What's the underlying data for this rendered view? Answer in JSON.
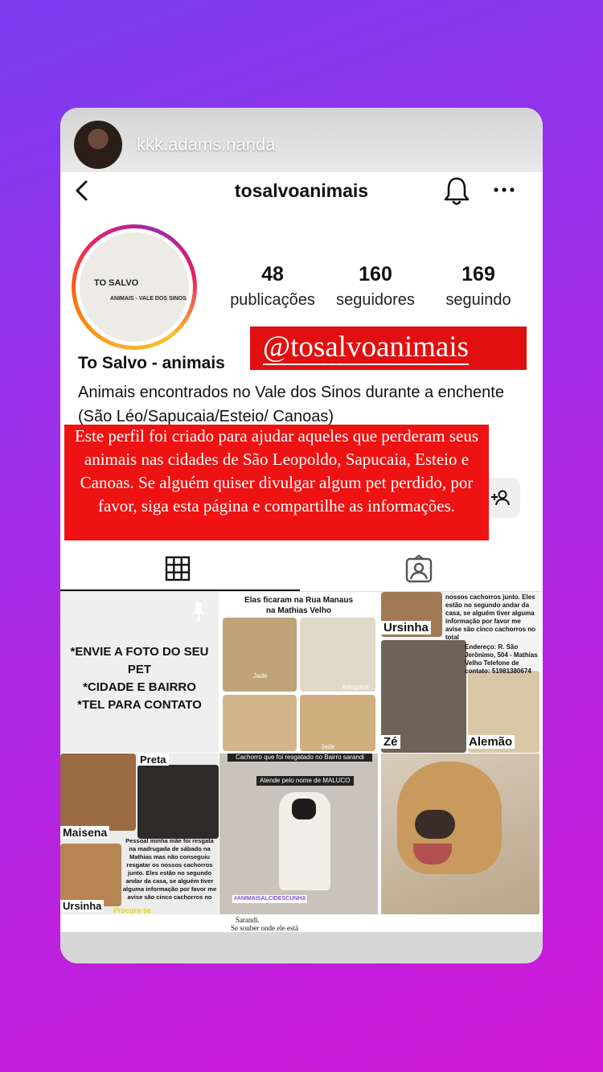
{
  "story": {
    "username": "kkk.adams.nanda"
  },
  "nav": {
    "title": "tosalvoanimais"
  },
  "profile": {
    "logo_title": "TO SALVO",
    "logo_subtitle": "ANIMAIS - VALE DOS SINOS",
    "name": "To Salvo - animais",
    "bio": "Animais encontrados no Vale dos Sinos durante a enchente (São Léo/Sapucaia/Esteio/ Canoas)"
  },
  "stats": [
    {
      "value": "48",
      "label": "publicações"
    },
    {
      "value": "160",
      "label": "seguidores"
    },
    {
      "value": "169",
      "label": "seguindo"
    }
  ],
  "overlay": {
    "handle": "@tosalvoanimais",
    "info": "Este perfil foi criado para ajudar aqueles que perderam seus animais nas cidades de São Leopoldo, Sapucaia, Esteio e Canoas. Se alguém quiser divulgar algum pet perdido, por favor, siga esta página e compartilhe as informações."
  },
  "posts": {
    "p1": {
      "line1": "*ENVIE A FOTO DO SEU PET",
      "line2": "*CIDADE E BAIRRO",
      "line3": "*TEL PARA CONTATO"
    },
    "p2": {
      "heading": "Elas ficaram na Rua Manaus na Mathias Velho",
      "dog1": "Jade",
      "dog2": "Arlequina",
      "dog3": "Jade"
    },
    "p3": {
      "top_text": "nossos cachorros junto. Eles estão no segundo andar da casa, se alguém tiver alguma informação por favor me avise são cinco cachorros no total",
      "name1": "Ursinha",
      "address": "Endereço: R. São Jerônimo, 504 - Mathias Velho Telefone de contato: 51981380674",
      "name2": "Zé",
      "name3": "Alemão"
    },
    "p4": {
      "name1": "Preta",
      "name2": "Maisena",
      "name3": "Ursinha",
      "text": "Pessoal minha mãe foi resgata na madrugada de sábado na Mathias mas não conseguiu resgatar os nossos cachorros junto. Eles estão no segundo andar da casa, se alguém tiver alguma informação por favor me avise são cinco cachorros no",
      "footer": "Procura-se"
    },
    "p5": {
      "top": "Cachorro que foi resgatado no Bairro sarandi",
      "name": "Atende pelo nome de MALUCO",
      "hashtag": "#ANIMAISALCIDESCUNHA",
      "bottom1": "Sarandi.",
      "bottom2": "Se souber onde ele está"
    }
  },
  "colors": {
    "banner_red": "#e10f0f",
    "bg_top": "#7a3cf0",
    "bg_bottom": "#d01ad8"
  }
}
